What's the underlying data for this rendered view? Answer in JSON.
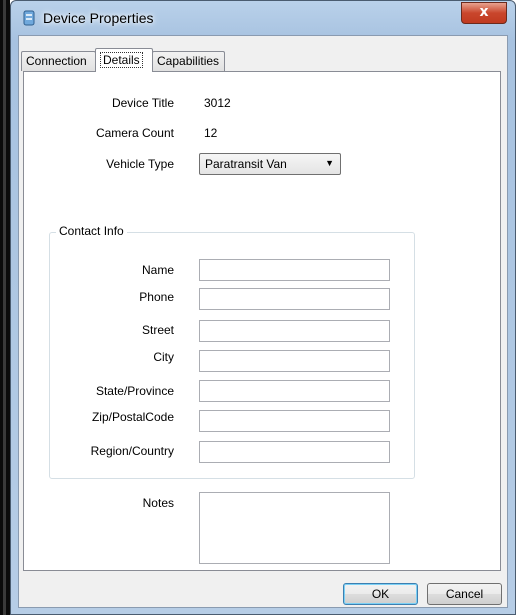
{
  "window": {
    "title": "Device Properties",
    "close_glyph": "x"
  },
  "tabs": [
    {
      "label": "Connection",
      "active": false
    },
    {
      "label": "Details",
      "active": true
    },
    {
      "label": "Capabilities",
      "active": false
    }
  ],
  "details": {
    "device_title_label": "Device Title",
    "device_title_value": "3012",
    "camera_count_label": "Camera Count",
    "camera_count_value": "12",
    "vehicle_type_label": "Vehicle Type",
    "vehicle_type_value": "Paratransit Van"
  },
  "contact": {
    "legend": "Contact Info",
    "name_label": "Name",
    "phone_label": "Phone",
    "street_label": "Street",
    "city_label": "City",
    "state_label": "State/Province",
    "zip_label": "Zip/PostalCode",
    "region_label": "Region/Country",
    "name_value": "",
    "phone_value": "",
    "street_value": "",
    "city_value": "",
    "state_value": "",
    "zip_value": "",
    "region_value": ""
  },
  "notes": {
    "label": "Notes",
    "value": ""
  },
  "buttons": {
    "ok": "OK",
    "cancel": "Cancel"
  },
  "icons": [
    "app-icon",
    "close-icon",
    "dropdown-arrow-icon"
  ]
}
